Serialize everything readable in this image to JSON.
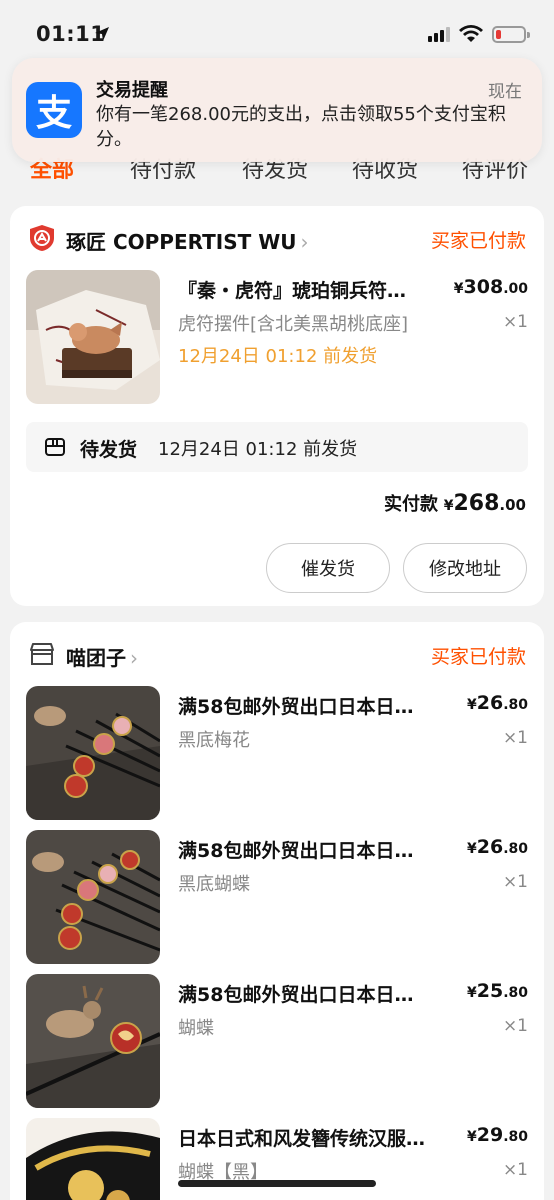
{
  "status_bar": {
    "time": "01:11"
  },
  "tabs": [
    {
      "label": "全部",
      "active": true
    },
    {
      "label": "待付款",
      "active": false
    },
    {
      "label": "待发货",
      "active": false
    },
    {
      "label": "待收货",
      "active": false
    },
    {
      "label": "待评价",
      "active": false
    }
  ],
  "notification": {
    "app_icon_glyph": "支",
    "title": "交易提醒",
    "time": "现在",
    "body": "你有一笔268.00元的支出，点击领取55个支付宝积分。"
  },
  "order1": {
    "shop_name": "琢匠 COPPERTIST WU",
    "status": "买家已付款",
    "item": {
      "title": "『秦・虎符』琥珀铜兵符…",
      "price_int": "308",
      "price_dec": ".00",
      "sku": "虎符摆件[含北美黑胡桃底座]",
      "qty": "×1",
      "ship_note": "12月24日 01:12 前发货"
    },
    "shipping": {
      "label": "待发货",
      "time": "12月24日 01:12 前发货"
    },
    "paid_label": "实付款",
    "paid_int": "268",
    "paid_dec": ".00",
    "buttons": {
      "urge": "催发货",
      "address": "修改地址"
    }
  },
  "order2": {
    "shop_name": "喵团子",
    "status": "买家已付款",
    "items": [
      {
        "title": "满58包邮外贸出口日本日…",
        "price_int": "26",
        "price_dec": ".80",
        "sku": "黑底梅花",
        "qty": "×1"
      },
      {
        "title": "满58包邮外贸出口日本日…",
        "price_int": "26",
        "price_dec": ".80",
        "sku": "黑底蝴蝶",
        "qty": "×1"
      },
      {
        "title": "满58包邮外贸出口日本日…",
        "price_int": "25",
        "price_dec": ".80",
        "sku": "蝴蝶",
        "qty": "×1"
      },
      {
        "title": "日本日式和风发簪传统汉服…",
        "price_int": "29",
        "price_dec": ".80",
        "sku": "蝴蝶【黑】",
        "qty": "×1"
      }
    ]
  },
  "currency_symbol": "¥",
  "colors": {
    "accent": "#ff5000",
    "ship_note": "#f0a030",
    "alipay_blue": "#1677ff"
  }
}
